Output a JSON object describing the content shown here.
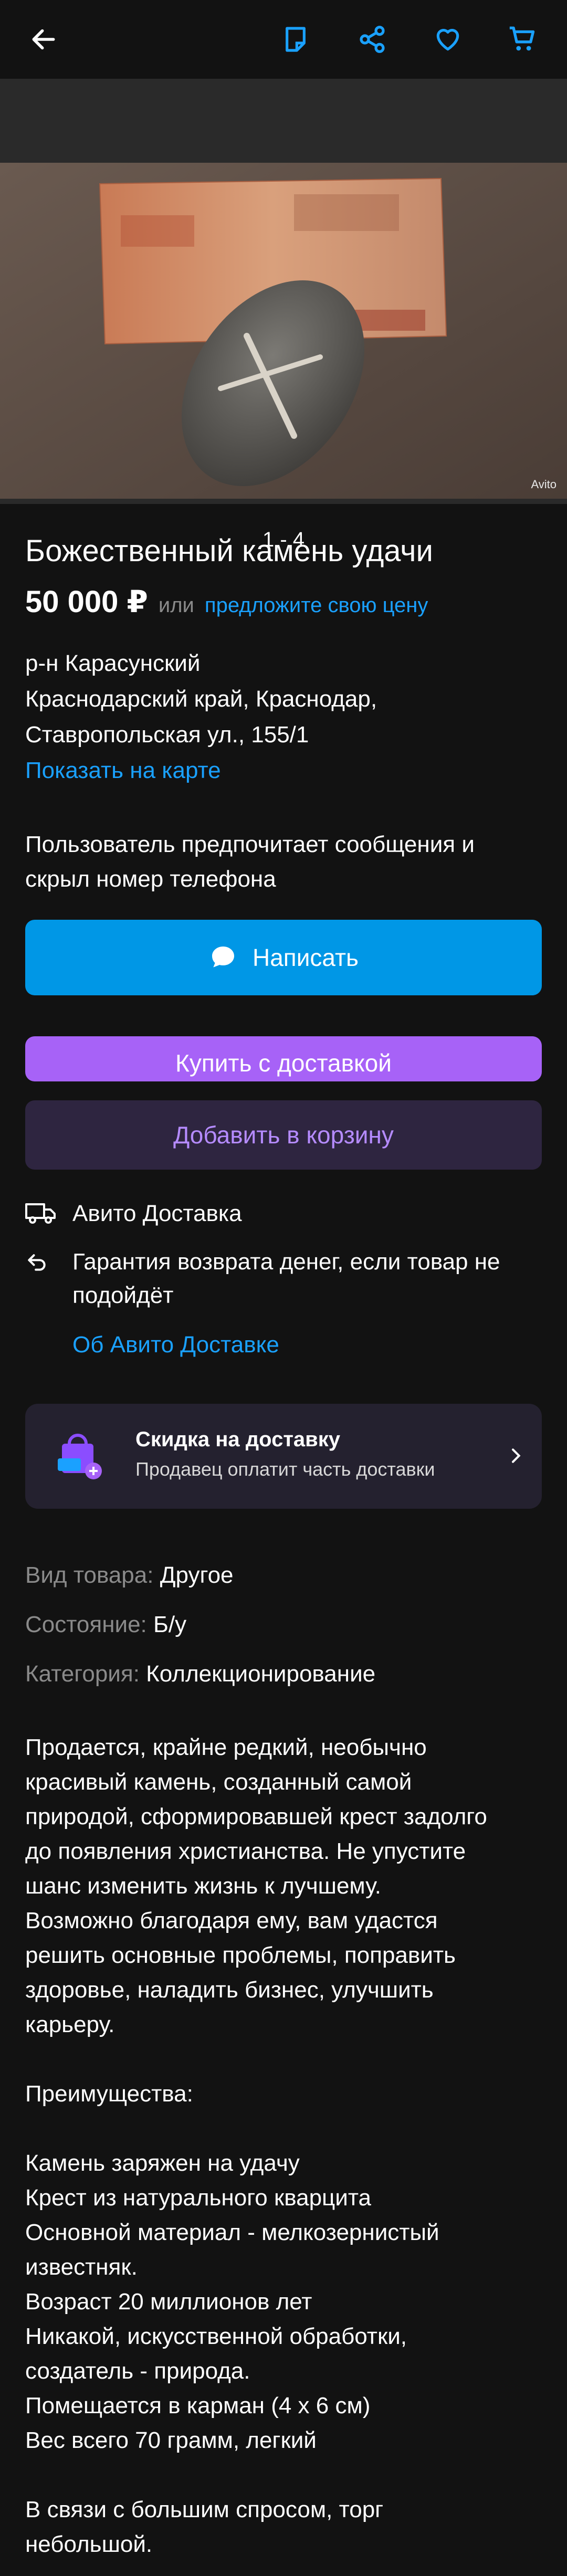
{
  "photo": {
    "counter": "1 - 4",
    "watermark": "Avito"
  },
  "listing": {
    "title": "Божественный камень удачи",
    "price": "50 000 ₽",
    "or_text": "или",
    "offer_link": "предложите свою цену",
    "address_lines": [
      "р-н Карасунский",
      "Краснодарский край, Краснодар,",
      "Ставропольская ул., 155/1"
    ],
    "map_link": "Показать на карте",
    "preference": "Пользователь предпочитает сообщения и скрыл номер телефона"
  },
  "buttons": {
    "write": "Написать",
    "buy": "Купить с доставкой",
    "cart": "Добавить в корзину"
  },
  "delivery": {
    "service": "Авито Доставка",
    "guarantee": "Гарантия возврата денег, если товар не подойдёт",
    "about_link": "Об Авито Доставке"
  },
  "promo": {
    "title": "Скидка на доставку",
    "subtitle": "Продавец оплатит часть доставки"
  },
  "specs": [
    {
      "key": "Вид товара:",
      "value": "Другое"
    },
    {
      "key": "Состояние:",
      "value": "Б/у"
    },
    {
      "key": "Категория:",
      "value": "Коллекционирование"
    }
  ],
  "description": {
    "p1": "Продается, крайне редкий, необычно\nкрасивый камень, созданный самой\nприродой, сформировавшей крест задолго\nдо появления христианства. Не упустите\nшанс изменить жизнь к лучшему.\nВозможно благодаря ему, вам удастся\nрешить основные проблемы, поправить\nздоровье, наладить бизнес, улучшить\nкарьеру.",
    "p2": "Преимущества:",
    "p3": "Камень заряжен на удачу\nКрест из натурального кварцита\nОсновной материал - мелкозернистый\nизвестняк.\nВозраст 20 миллионов лет\nНикакой, искусственной обработки,\nсоздатель - природа.\nПомещается в карман (4 х 6 см)\nВес всего 70 грамм, легкий",
    "p4": "В связи с большим спросом, торг\nнебольшой."
  },
  "colors": {
    "background": "#121212",
    "accent_blue": "#0097e6",
    "link_blue": "#1aa1ff",
    "accent_purple": "#a762f7"
  }
}
